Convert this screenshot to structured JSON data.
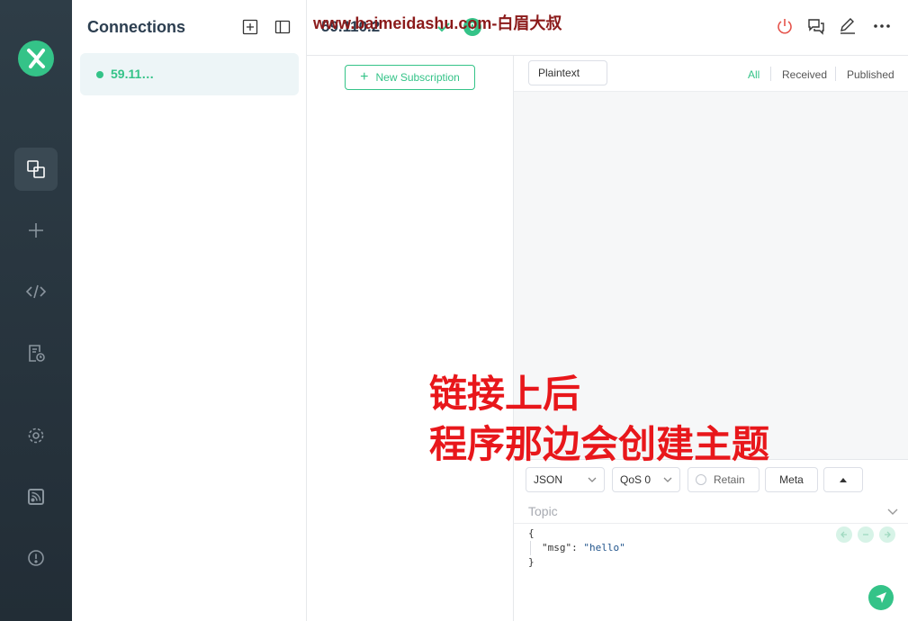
{
  "sidebar": {
    "logo_icon": "mqttx-logo",
    "items": [
      {
        "icon": "connections-icon",
        "active": true
      },
      {
        "icon": "plus-icon"
      },
      {
        "icon": "code-icon"
      },
      {
        "icon": "log-icon"
      },
      {
        "icon": "gear-icon"
      },
      {
        "icon": "rss-icon"
      },
      {
        "icon": "info-icon"
      }
    ]
  },
  "connections": {
    "title": "Connections",
    "items": [
      {
        "name": "59.11…",
        "status": "connected"
      }
    ]
  },
  "header": {
    "title": "59.110.2",
    "badge": "0",
    "watermark": "www.baimeidashu.com-白眉大叔"
  },
  "topics": {
    "new_subscription": "New Subscription"
  },
  "messages": {
    "format": "Plaintext",
    "filters": [
      "All",
      "Received",
      "Published"
    ],
    "active_filter": "All"
  },
  "overlay": {
    "line1": "链接上后",
    "line2": "程序那边会创建主题"
  },
  "publish": {
    "format": "JSON",
    "qos": "QoS 0",
    "retain": "Retain",
    "meta": "Meta",
    "topic_placeholder": "Topic",
    "payload": {
      "open": "{",
      "key": "\"msg\"",
      "sep": ": ",
      "value": "\"hello\"",
      "close": "}"
    }
  },
  "colors": {
    "accent": "#34c388",
    "rail_bg": "#2e3d47",
    "overlay_text": "#e8171b",
    "watermark": "#8b1a1a"
  }
}
